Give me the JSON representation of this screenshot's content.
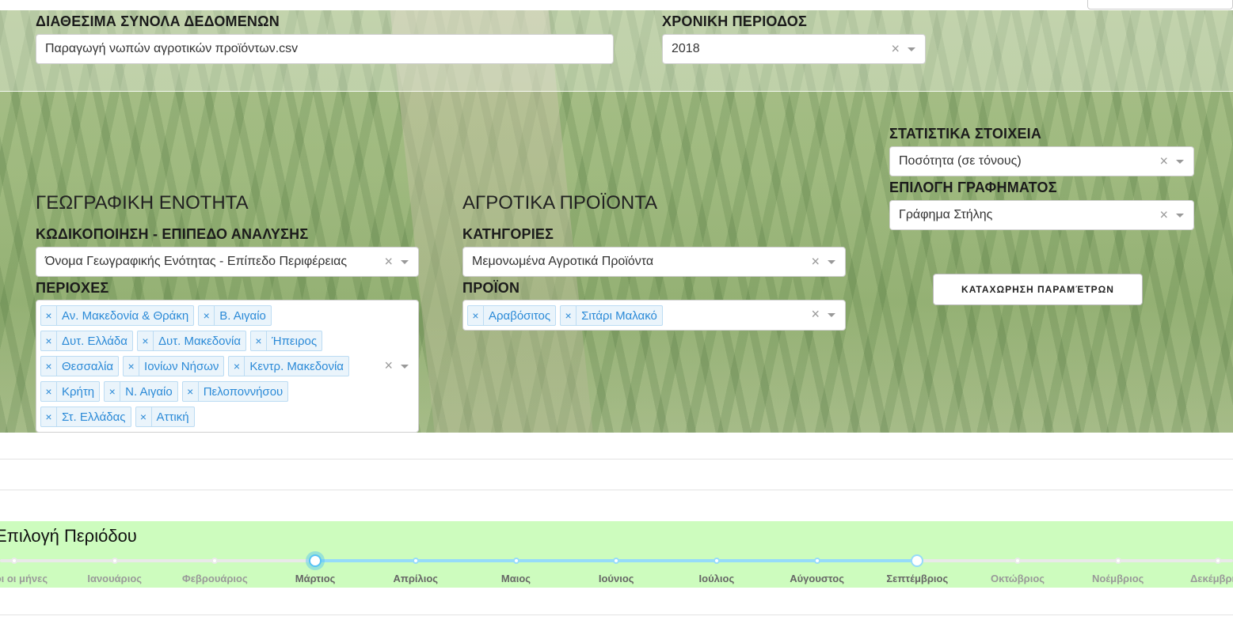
{
  "datasets": {
    "label": "ΔΙΑΘΕΣΙΜΑ ΣΥΝΟΛΑ ΔΕΔΟΜΕΝΩΝ",
    "value": "Παραγωγή νωπών αγροτικών προϊόντων.csv"
  },
  "time_period": {
    "label": "ΧΡΟΝΙΚΗ ΠΕΡΙΟΔΟΣ",
    "value": "2018"
  },
  "geography": {
    "title": "ΓΕΩΓΡΑΦΙΚΗ ΕΝΟΤΗΤΑ",
    "coding_label": "ΚΩΔΙΚΟΠΟΙΗΣΗ - ΕΠΙΠΕΔΟ ΑΝΑΛΥΣΗΣ",
    "coding_value": "Όνομα Γεωγραφικής Ενότητας - Επίπεδο Περιφέρειας",
    "regions_label": "ΠΕΡΙΟΧΕΣ",
    "regions": [
      "Αν. Μακεδονία & Θράκη",
      "Β. Αιγαίο",
      "Δυτ. Ελλάδα",
      "Δυτ. Μακεδονία",
      "Ήπειρος",
      "Θεσσαλία",
      "Ιονίων Νήσων",
      "Κεντρ. Μακεδονία",
      "Κρήτη",
      "Ν. Αιγαίο",
      "Πελοποννήσου",
      "Στ. Ελλάδας",
      "Αττική"
    ]
  },
  "products": {
    "title": "ΑΓΡΟΤΙΚΑ ΠΡΟΪΟΝΤΑ",
    "categories_label": "ΚΑΤΗΓΟΡΙΕΣ",
    "categories_value": "Μεμονωμένα Αγροτικά Προϊόντα",
    "product_label": "ΠΡΟΪΟΝ",
    "product_values": [
      "Αραβόσιτος",
      "Σιτάρι Μαλακό"
    ]
  },
  "stats": {
    "label": "ΣΤΑΤΙΣΤΙΚΑ ΣΤΟΙΧΕΙΑ",
    "value": "Ποσότητα (σε τόνους)"
  },
  "chart_select": {
    "label": "ΕΠΙΛΟΓΗ ΓΡΑΦΗΜΑΤΟΣ",
    "value": "Γράφημα Στήλης"
  },
  "submit_label": "ΚΑΤΑΧΩΡΗΣΗ ΠΑΡΑΜΈΤΡΩΝ",
  "clear_symbol": "×",
  "period": {
    "title": "Επιλογή Περιόδου",
    "marks": [
      "Όλοι οι μήνες",
      "Ιανουάριος",
      "Φεβρουάριος",
      "Μάρτιος",
      "Απρίλιος",
      "Μαιος",
      "Ιούνιος",
      "Ιούλιος",
      "Αύγουστος",
      "Σεπτέμβριος",
      "Οκτώβριος",
      "Νοέμβριος",
      "Δεκέμβριος"
    ],
    "range_start_index": 3,
    "range_end_index": 9
  },
  "colors": {
    "chip_text": "#2b8ad7",
    "chip_bg": "#eaf4fb",
    "slider_track": "#96dbfa",
    "period_bg": "#cdfcbe"
  }
}
